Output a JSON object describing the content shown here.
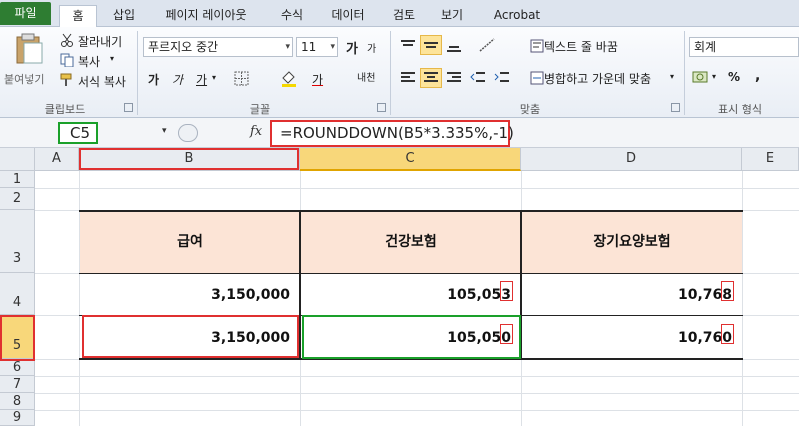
{
  "menu": {
    "tabs": [
      "파일",
      "홈",
      "삽입",
      "페이지 레이아웃",
      "수식",
      "데이터",
      "검토",
      "보기",
      "Acrobat"
    ]
  },
  "ribbon": {
    "clipboard": {
      "paste": "붙여넣기",
      "cut": "잘라내기",
      "copy": "복사",
      "format_painter": "서식 복사",
      "group": "클립보드"
    },
    "font": {
      "name": "푸르지오 중간",
      "size": "11",
      "bold": "가",
      "italic": "가",
      "underline": "가",
      "grow": "가",
      "shrink": "가",
      "color_a": "가",
      "phonetic": "내천",
      "group": "글꼴"
    },
    "alignment": {
      "wrap": "텍스트 줄 바꿈",
      "merge": "병합하고 가운데 맞춤",
      "group": "맞춤"
    },
    "number": {
      "format": "회계",
      "percent": "%",
      "comma": ",",
      "group": "표시 형식"
    }
  },
  "formula_bar": {
    "name_box": "C5",
    "fx": "fx",
    "formula": "=ROUNDDOWN(B5*3.335%,-1)"
  },
  "sheet": {
    "columns": [
      "A",
      "B",
      "C",
      "D",
      "E"
    ],
    "rows": [
      "1",
      "2",
      "3",
      "4",
      "5",
      "6",
      "7",
      "8",
      "9"
    ],
    "headers": [
      "급여",
      "건강보험",
      "장기요양보험"
    ],
    "row4": [
      "3,150,000",
      "105,053",
      "10,768"
    ],
    "row5": [
      "3,150,000",
      "105,050",
      "10,760"
    ]
  },
  "colors": {
    "header_fill": "#fce4d6",
    "highlight_red": "#e03030",
    "highlight_green": "#1aa02a",
    "selected_header": "#f8d77a"
  }
}
